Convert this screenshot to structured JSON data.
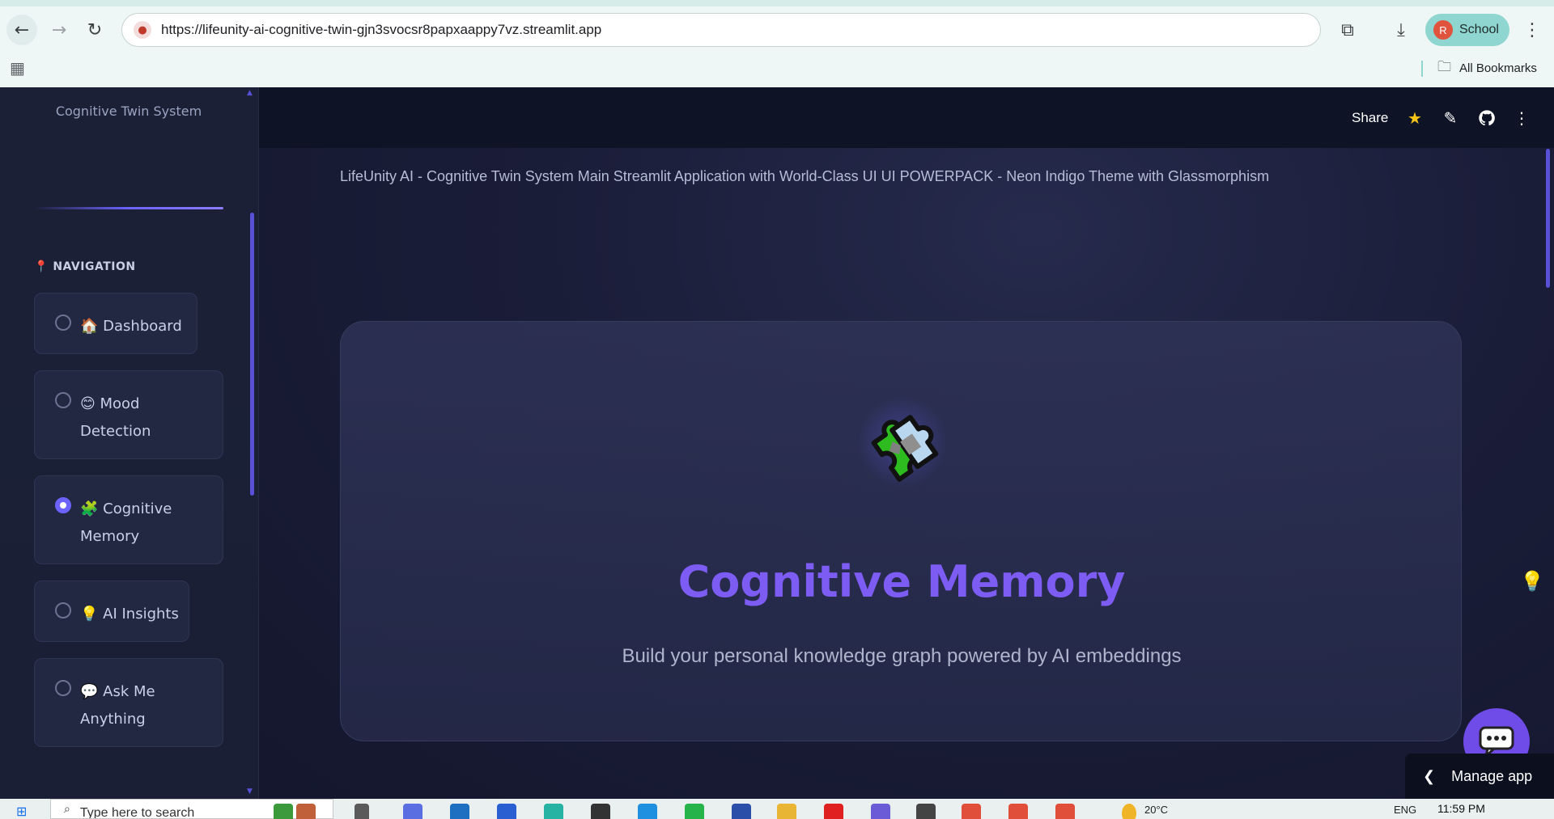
{
  "browser": {
    "url": "https://lifeunity-ai-cognitive-twin-gjn3svocsr8papxaappy7vz.streamlit.app",
    "profile_initial": "R",
    "profile_name": "School",
    "bookmarks_label": "All Bookmarks"
  },
  "sidebar": {
    "title": "Cognitive Twin System",
    "nav_heading_icon": "📍",
    "nav_heading": "NAVIGATION",
    "items": [
      {
        "icon": "🏠",
        "label": "Dashboard",
        "selected": false
      },
      {
        "icon": "😊",
        "label": "Mood Detection",
        "selected": false
      },
      {
        "icon": "🧩",
        "label": "Cognitive Memory",
        "selected": true
      },
      {
        "icon": "💡",
        "label": "AI Insights",
        "selected": false
      },
      {
        "icon": "💬",
        "label": "Ask Me Anything",
        "selected": false
      }
    ]
  },
  "header": {
    "share_label": "Share"
  },
  "main": {
    "intro": "LifeUnity AI - Cognitive Twin System Main Streamlit Application with World-Class UI UI POWERPACK - Neon Indigo Theme with Glassmorphism",
    "hero_title": "Cognitive Memory",
    "hero_subtitle": "Build your personal knowledge graph powered by AI embeddings"
  },
  "footer": {
    "manage_app_label": "Manage app"
  },
  "taskbar": {
    "search_placeholder": "Type here to search",
    "temperature": "20°C",
    "language": "ENG",
    "time": "11:59 PM"
  },
  "colors": {
    "accent": "#6c63ff",
    "hero_title": "#7c5cf2",
    "chat_fab": "#6f4be8"
  }
}
